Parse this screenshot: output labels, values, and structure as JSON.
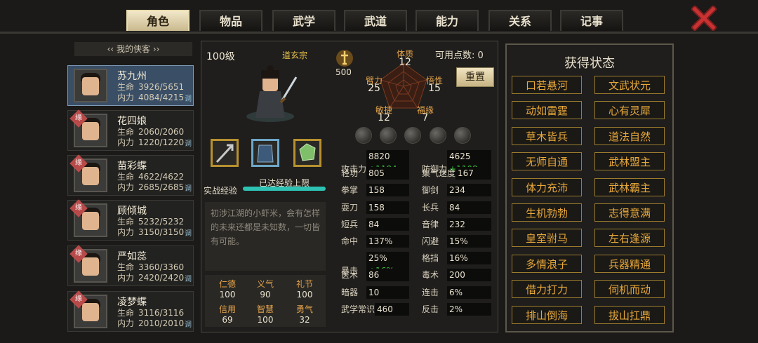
{
  "tabs": [
    {
      "label": "角色",
      "active": true
    },
    {
      "label": "物品",
      "active": false
    },
    {
      "label": "武学",
      "active": false
    },
    {
      "label": "武道",
      "active": false
    },
    {
      "label": "能力",
      "active": false
    },
    {
      "label": "关系",
      "active": false
    },
    {
      "label": "记事",
      "active": false
    }
  ],
  "list_title": "我的侠客",
  "heroes": [
    {
      "name": "苏九州",
      "hp": "3926/5651",
      "mp": "4084/4215",
      "adjust": "调",
      "badge": "",
      "selected": true
    },
    {
      "name": "花四娘",
      "hp": "2060/2060",
      "mp": "1220/1220",
      "adjust": "调",
      "badge": "缘",
      "selected": false
    },
    {
      "name": "苗彩蝶",
      "hp": "4622/4622",
      "mp": "2685/2685",
      "adjust": "调",
      "badge": "缘",
      "selected": false
    },
    {
      "name": "顾倾城",
      "hp": "5232/5232",
      "mp": "3150/3150",
      "adjust": "调",
      "badge": "缘",
      "selected": false
    },
    {
      "name": "严如蕊",
      "hp": "3360/3360",
      "mp": "2420/2420",
      "adjust": "调",
      "badge": "缘",
      "selected": false
    },
    {
      "name": "凌梦蝶",
      "hp": "3116/3116",
      "mp": "2010/2010",
      "adjust": "调",
      "badge": "缘",
      "selected": false
    }
  ],
  "labels": {
    "hp": "生命",
    "mp": "内力"
  },
  "character": {
    "level": "100级",
    "sect": "道玄宗",
    "rank_value": "500",
    "points_label": "可用点数: 0",
    "reset": "重置",
    "exp_label": "实战经验",
    "exp_status": "已达经验上限",
    "exp_fill": 1.0,
    "description": "初涉江湖的小虾米，会有怎样的未来还都是未知数，一切皆有可能。"
  },
  "attributes": [
    {
      "name": "体质",
      "value": "12"
    },
    {
      "name": "悟性",
      "value": "15"
    },
    {
      "name": "福缘",
      "value": "7"
    },
    {
      "name": "敏捷",
      "value": "12"
    },
    {
      "name": "臂力",
      "value": "25"
    }
  ],
  "virtues": [
    {
      "name": "仁德",
      "value": "100"
    },
    {
      "name": "义气",
      "value": "90"
    },
    {
      "name": "礼节",
      "value": "100"
    },
    {
      "name": "信用",
      "value": "69"
    },
    {
      "name": "智慧",
      "value": "100"
    },
    {
      "name": "勇气",
      "value": "32"
    }
  ],
  "stats_left": [
    {
      "name": "攻击力",
      "value": "8820",
      "bonus": "+1184"
    },
    {
      "name": "轻功",
      "value": "805",
      "bonus": ""
    },
    {
      "name": "拳掌",
      "value": "158",
      "bonus": ""
    },
    {
      "name": "耍刀",
      "value": "158",
      "bonus": ""
    },
    {
      "name": "短兵",
      "value": "84",
      "bonus": ""
    },
    {
      "name": "命中",
      "value": "137%",
      "bonus": ""
    },
    {
      "name": "暴击",
      "value": "25%",
      "bonus": "+16%"
    },
    {
      "name": "医术",
      "value": "86",
      "bonus": ""
    },
    {
      "name": "暗器",
      "value": "10",
      "bonus": ""
    },
    {
      "name": "武学常识",
      "value": "460",
      "bonus": ""
    }
  ],
  "stats_right": [
    {
      "name": "防御力",
      "value": "4625",
      "bonus": "+1108"
    },
    {
      "name": "集气速度",
      "value": "167",
      "bonus": ""
    },
    {
      "name": "御剑",
      "value": "234",
      "bonus": ""
    },
    {
      "name": "长兵",
      "value": "84",
      "bonus": ""
    },
    {
      "name": "音律",
      "value": "232",
      "bonus": ""
    },
    {
      "name": "闪避",
      "value": "15%",
      "bonus": ""
    },
    {
      "name": "格挡",
      "value": "16%",
      "bonus": ""
    },
    {
      "name": "毒术",
      "value": "200",
      "bonus": ""
    },
    {
      "name": "连击",
      "value": "6%",
      "bonus": ""
    },
    {
      "name": "反击",
      "value": "2%",
      "bonus": ""
    }
  ],
  "status_title": "获得状态",
  "statuses": [
    "口若悬河",
    "文武状元",
    "动如雷霆",
    "心有灵犀",
    "草木皆兵",
    "道法自然",
    "无师自通",
    "武林盟主",
    "体力充沛",
    "武林霸主",
    "生机勃勃",
    "志得意满",
    "皇室驸马",
    "左右逢源",
    "多情浪子",
    "兵器精通",
    "借力打力",
    "伺机而动",
    "排山倒海",
    "拔山扛鼎"
  ],
  "colors": {
    "accent": "#e8a83a",
    "selected": "#3a4f66",
    "bonus": "#3bbf3b",
    "exp_bar": "#2ec2b3"
  }
}
